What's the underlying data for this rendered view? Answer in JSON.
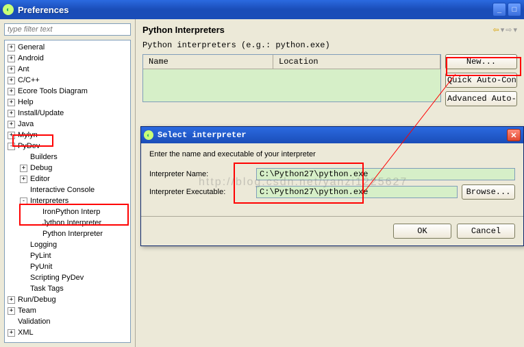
{
  "window": {
    "title": "Preferences"
  },
  "sidebar": {
    "filter_placeholder": "type filter text",
    "items": [
      {
        "label": "General",
        "exp": "+",
        "d": 0
      },
      {
        "label": "Android",
        "exp": "+",
        "d": 0
      },
      {
        "label": "Ant",
        "exp": "+",
        "d": 0
      },
      {
        "label": "C/C++",
        "exp": "+",
        "d": 0
      },
      {
        "label": "Ecore Tools Diagram",
        "exp": "+",
        "d": 0
      },
      {
        "label": "Help",
        "exp": "+",
        "d": 0
      },
      {
        "label": "Install/Update",
        "exp": "+",
        "d": 0
      },
      {
        "label": "Java",
        "exp": "+",
        "d": 0
      },
      {
        "label": "Mylyn",
        "exp": "+",
        "d": 0
      },
      {
        "label": "PyDev",
        "exp": "-",
        "d": 0
      },
      {
        "label": "Builders",
        "exp": "",
        "d": 1
      },
      {
        "label": "Debug",
        "exp": "+",
        "d": 1
      },
      {
        "label": "Editor",
        "exp": "+",
        "d": 1
      },
      {
        "label": "Interactive Console",
        "exp": "",
        "d": 1
      },
      {
        "label": "Interpreters",
        "exp": "-",
        "d": 1
      },
      {
        "label": "IronPython Interp",
        "exp": "",
        "d": 2
      },
      {
        "label": "Jython Interpreter",
        "exp": "",
        "d": 2
      },
      {
        "label": "Python Interpreter",
        "exp": "",
        "d": 2
      },
      {
        "label": "Logging",
        "exp": "",
        "d": 1
      },
      {
        "label": "PyLint",
        "exp": "",
        "d": 1
      },
      {
        "label": "PyUnit",
        "exp": "",
        "d": 1
      },
      {
        "label": "Scripting PyDev",
        "exp": "",
        "d": 1
      },
      {
        "label": "Task Tags",
        "exp": "",
        "d": 1
      },
      {
        "label": "Run/Debug",
        "exp": "+",
        "d": 0
      },
      {
        "label": "Team",
        "exp": "+",
        "d": 0
      },
      {
        "label": "Validation",
        "exp": "",
        "d": 0
      },
      {
        "label": "XML",
        "exp": "+",
        "d": 0
      }
    ]
  },
  "content": {
    "title": "Python Interpreters",
    "subtitle": "Python interpreters (e.g.: python.exe)",
    "table_headers": {
      "name": "Name",
      "location": "Location"
    },
    "buttons": {
      "new": "New...",
      "quick": "Quick Auto-Confi",
      "advanced": "Advanced Auto-Con"
    }
  },
  "dialog": {
    "title": "Select interpreter",
    "instruction": "Enter the name and executable of your interpreter",
    "name_label": "Interpreter Name:",
    "name_value": "C:\\Python27\\python.exe",
    "exec_label": "Interpreter Executable:",
    "exec_value": "C:\\Python27\\python.exe",
    "browse": "Browse...",
    "ok": "OK",
    "cancel": "Cancel"
  },
  "watermark": "http://blog.csdn.net/yanzi1225627"
}
